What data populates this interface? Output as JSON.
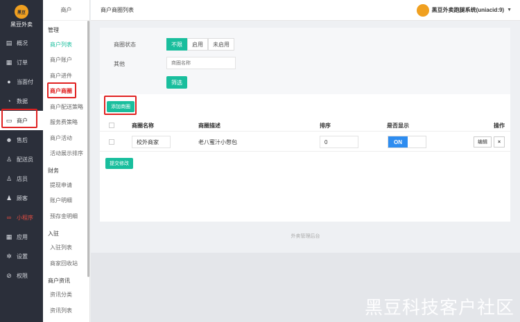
{
  "brand": {
    "logo_text": "黑豆",
    "name": "黑豆外卖"
  },
  "nav": [
    {
      "label": "概况",
      "icon": "dashboard-icon"
    },
    {
      "label": "订单",
      "icon": "order-icon"
    },
    {
      "label": "当面付",
      "icon": "pay-icon"
    },
    {
      "label": "数据",
      "icon": "data-icon"
    },
    {
      "label": "商户",
      "icon": "store-icon",
      "active": true
    },
    {
      "label": "售后",
      "icon": "service-icon"
    },
    {
      "label": "配送员",
      "icon": "courier-icon"
    },
    {
      "label": "店员",
      "icon": "clerk-icon"
    },
    {
      "label": "顾客",
      "icon": "customer-icon"
    },
    {
      "label": "小程序",
      "icon": "miniapp-icon",
      "red": true
    },
    {
      "label": "应用",
      "icon": "apps-icon"
    },
    {
      "label": "设置",
      "icon": "settings-icon"
    },
    {
      "label": "权限",
      "icon": "permission-icon"
    }
  ],
  "sub": {
    "head": "商户",
    "groups": [
      {
        "title": "管理",
        "items": [
          "商户列表",
          "商户账户",
          "商户进件",
          "商户商圈",
          "商户配送策略",
          "服务费策略",
          "商户活动",
          "活动展示排序"
        ]
      },
      {
        "title": "财务",
        "items": [
          "提现申请",
          "账户明细",
          "预存金明细"
        ]
      },
      {
        "title": "入驻",
        "items": [
          "入驻列表",
          "商家回收站"
        ]
      },
      {
        "title": "商户资讯",
        "items": [
          "资讯分类",
          "资讯列表"
        ]
      }
    ]
  },
  "topbar": {
    "title": "商户商圈列表",
    "account": "黑豆外卖跑腿系统(uniacid:9)"
  },
  "filter": {
    "status_label": "商圈状态",
    "status_options": [
      "不限",
      "启用",
      "未启用"
    ],
    "other_label": "其他",
    "search_placeholder": "商圈名称",
    "filter_button": "筛选"
  },
  "add_button": "添加商圈",
  "table": {
    "headers": [
      "商圈名称",
      "商圈描述",
      "排序",
      "是否显示",
      "操作"
    ],
    "rows": [
      {
        "name": "校外商家",
        "desc": "老八蜜汁小憋包",
        "order": "0",
        "show": "ON",
        "edit": "编辑",
        "delete": "×"
      }
    ]
  },
  "submit_button": "提交修改",
  "footer": "外卖管理后台",
  "watermark": "黑豆科技客户社区",
  "colors": {
    "accent": "#19be9d",
    "sidebar": "#2b2f3a",
    "highlight": "#e02020",
    "toggle_on": "#2d8cf0"
  }
}
